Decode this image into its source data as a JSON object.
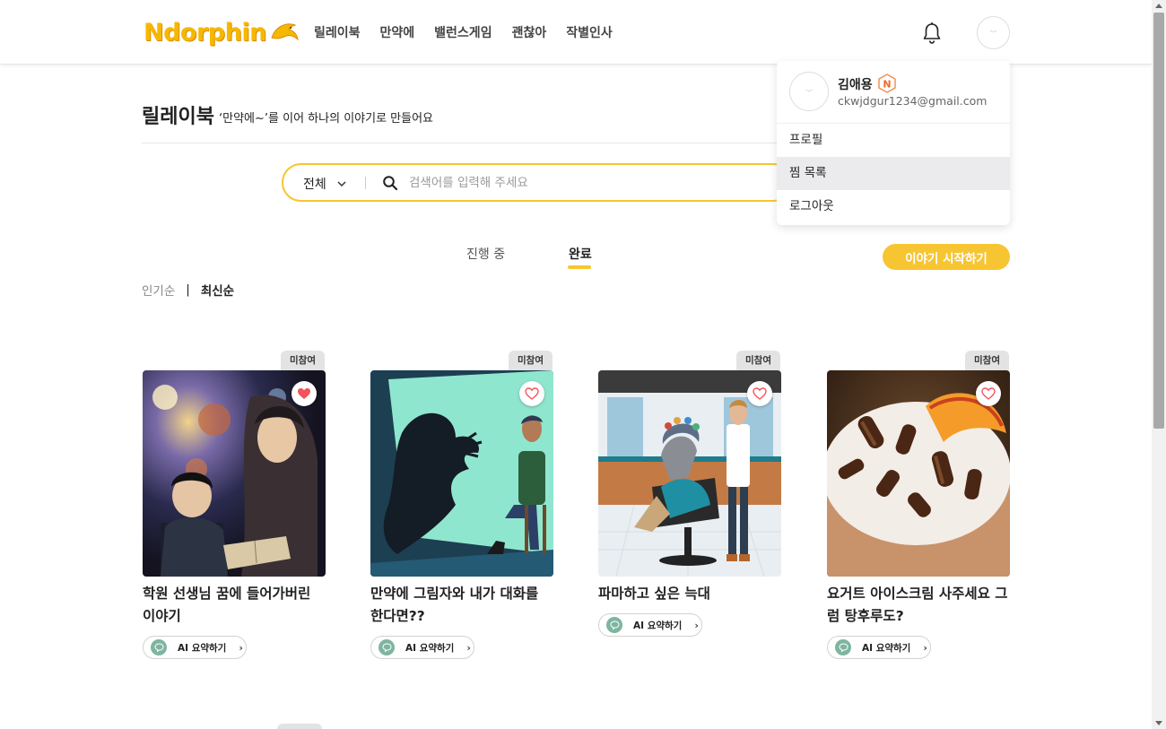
{
  "header": {
    "logo_text": "Ndorphin",
    "nav": [
      "릴레이북",
      "만약에",
      "밸런스게임",
      "괜찮아",
      "작별인사"
    ],
    "bell_icon": "bell-icon",
    "avatar_text": "ᵔᵕᵔ"
  },
  "user_menu": {
    "name": "김애용",
    "badge": "N",
    "email": "ckwjdgur1234@gmail.com",
    "items": [
      "프로필",
      "찜 목록",
      "로그아웃"
    ],
    "active_item": "찜 목록"
  },
  "page": {
    "title": "릴레이북",
    "subtitle": "‘만약에~’를 이어 하나의 이야기로 만들어요"
  },
  "search": {
    "filter_value": "전체",
    "placeholder": "검색어를 입력해 주세요"
  },
  "tabs": [
    "진행 중",
    "완료"
  ],
  "active_tab": "완료",
  "start_button": "이야기 시작하기",
  "sort": {
    "popular": "인기순",
    "separator": "|",
    "latest": "최신순",
    "active": "최신순"
  },
  "colors": {
    "accent": "#f7c531",
    "heart": "#f2545b",
    "ai_icon": "#7fb5a0"
  },
  "cards": [
    {
      "badge": "미참여",
      "title": "학원 선생님 꿈에 들어가버린 이야기",
      "liked": true,
      "ai_label": "AI 요약하기"
    },
    {
      "badge": "미참여",
      "title": "만약에 그림자와 내가 대화를 한다면??",
      "liked": false,
      "ai_label": "AI 요약하기"
    },
    {
      "badge": "미참여",
      "title": "파마하고 싶은 늑대",
      "liked": false,
      "ai_label": "AI 요약하기"
    },
    {
      "badge": "미참여",
      "title": "요거트 아이스크림 사주세요 그럼 탕후루도?",
      "liked": false,
      "ai_label": "AI 요약하기"
    }
  ]
}
